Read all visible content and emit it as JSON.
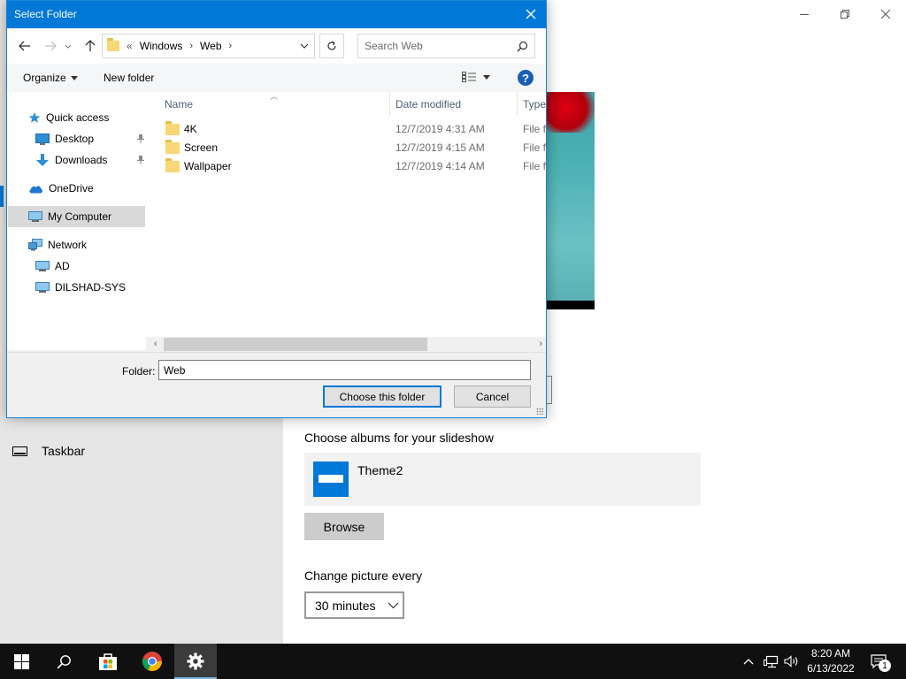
{
  "settings": {
    "sidebar": {
      "taskbar_label": "Taskbar"
    },
    "albums_label": "Choose albums for your slideshow",
    "album_name": "Theme2",
    "browse_label": "Browse",
    "change_picture_label": "Change picture every",
    "interval_value": "30 minutes"
  },
  "dialog": {
    "title": "Select Folder",
    "breadcrumb": {
      "overflow": "«",
      "segments": [
        "Windows",
        "Web"
      ]
    },
    "search_placeholder": "Search Web",
    "commands": {
      "organize": "Organize",
      "new_folder": "New folder"
    },
    "nav": {
      "quick_access": "Quick access",
      "desktop": "Desktop",
      "downloads": "Downloads",
      "onedrive": "OneDrive",
      "my_computer": "My Computer",
      "network": "Network",
      "ad": "AD",
      "dilshad": "DILSHAD-SYS"
    },
    "columns": {
      "name": "Name",
      "date": "Date modified",
      "type": "Type"
    },
    "files": [
      {
        "name": "4K",
        "date": "12/7/2019 4:31 AM",
        "type": "File fo"
      },
      {
        "name": "Screen",
        "date": "12/7/2019 4:15 AM",
        "type": "File fo"
      },
      {
        "name": "Wallpaper",
        "date": "12/7/2019 4:14 AM",
        "type": "File fo"
      }
    ],
    "folder_label": "Folder:",
    "folder_value": "Web",
    "choose_label": "Choose this folder",
    "cancel_label": "Cancel"
  },
  "taskbar": {
    "time": "8:20 AM",
    "date": "6/13/2022",
    "notification_count": "1"
  },
  "colors": {
    "accent": "#0078d7",
    "taskbar": "#101010",
    "folder": "#f8d775"
  }
}
